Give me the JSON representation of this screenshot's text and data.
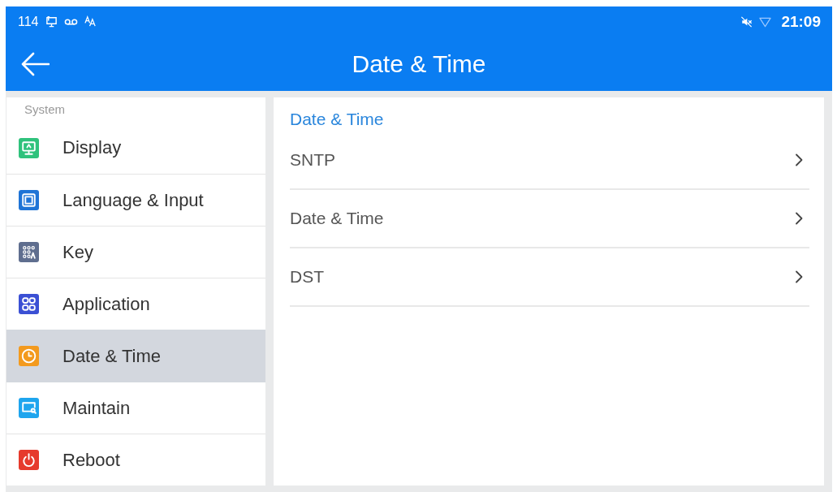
{
  "status_bar": {
    "left_text": "114",
    "time": "21:09"
  },
  "app_bar": {
    "title": "Date & Time"
  },
  "sidebar": {
    "section": "System",
    "items": [
      {
        "label": "Display",
        "color": "#2fc27c",
        "selected": false
      },
      {
        "label": "Language & Input",
        "color": "#1f74d6",
        "selected": false
      },
      {
        "label": "Key",
        "color": "#5f6e8f",
        "selected": false
      },
      {
        "label": "Application",
        "color": "#3b50d4",
        "selected": false
      },
      {
        "label": "Date & Time",
        "color": "#f39a1e",
        "selected": true
      },
      {
        "label": "Maintain",
        "color": "#1ea5ee",
        "selected": false
      },
      {
        "label": "Reboot",
        "color": "#e63a2c",
        "selected": false
      }
    ]
  },
  "content": {
    "heading": "Date & Time",
    "rows": [
      {
        "label": "SNTP"
      },
      {
        "label": "Date & Time"
      },
      {
        "label": "DST"
      }
    ]
  }
}
